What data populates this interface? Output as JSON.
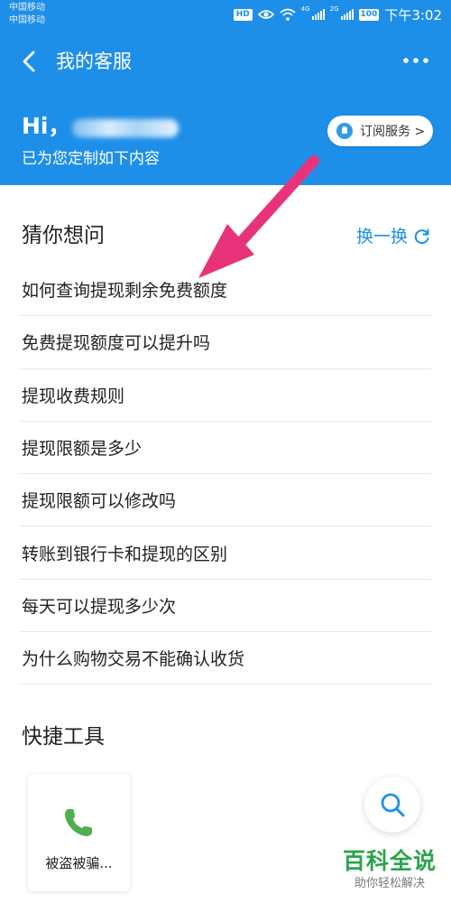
{
  "status_bar": {
    "carrier_1": "中国移动",
    "carrier_2": "中国移动",
    "hd": "HD",
    "net_1": "4G",
    "net_2": "2G",
    "battery": "100",
    "time": "下午3:02"
  },
  "header": {
    "title": "我的客服",
    "greeting": "Hi，",
    "subtitle": "已为您定制如下内容",
    "subscribe_label": "订阅服务 >"
  },
  "guess": {
    "title": "猜你想问",
    "refresh_label": "换一换",
    "questions": [
      "如何查询提现剩余免费额度",
      "免费提现额度可以提升吗",
      "提现收费规则",
      "提现限额是多少",
      "提现限额可以修改吗",
      "转账到银行卡和提现的区别",
      "每天可以提现多少次",
      "为什么购物交易不能确认收货"
    ]
  },
  "tools": {
    "title": "快捷工具",
    "items": [
      {
        "label": "被盗被骗...",
        "icon": "phone-icon"
      }
    ]
  },
  "watermark": {
    "title": "百科全说",
    "subtitle": "助你轻松解决"
  },
  "colors": {
    "brand_blue": "#1e8fe8",
    "annotation_pink": "#e8337a",
    "phone_green": "#4caf50",
    "watermark_green": "#2aa44a"
  }
}
